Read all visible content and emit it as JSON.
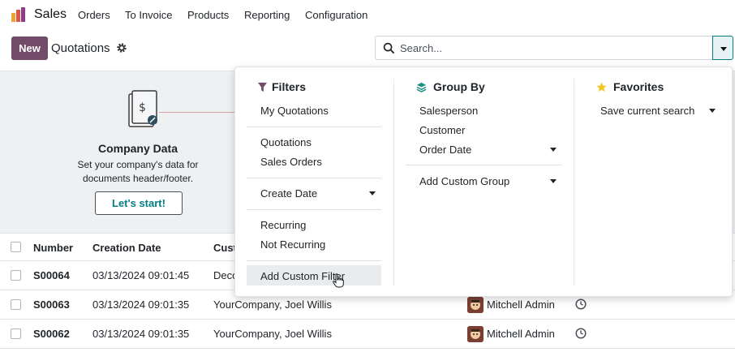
{
  "navbar": {
    "app_name": "Sales",
    "menu": [
      "Orders",
      "To Invoice",
      "Products",
      "Reporting",
      "Configuration"
    ]
  },
  "control": {
    "new_label": "New",
    "breadcrumb": "Quotations",
    "search_placeholder": "Search..."
  },
  "onboarding": {
    "title": "Company Data",
    "description": "Set your company's data for documents header/footer.",
    "button": "Let's start!"
  },
  "list": {
    "columns": [
      "Number",
      "Creation Date",
      "Cust"
    ],
    "rows": [
      {
        "number": "S00064",
        "date": "03/13/2024 09:01:45",
        "customer": "Deco",
        "salesperson": ""
      },
      {
        "number": "S00063",
        "date": "03/13/2024 09:01:35",
        "customer": "YourCompany, Joel Willis",
        "salesperson": "Mitchell Admin"
      },
      {
        "number": "S00062",
        "date": "03/13/2024 09:01:35",
        "customer": "YourCompany, Joel Willis",
        "salesperson": "Mitchell Admin"
      }
    ]
  },
  "filters": {
    "title": "Filters",
    "my_quotations": "My Quotations",
    "quotations": "Quotations",
    "sales_orders": "Sales Orders",
    "create_date": "Create Date",
    "recurring": "Recurring",
    "not_recurring": "Not Recurring",
    "add_custom": "Add Custom Filter"
  },
  "groupby": {
    "title": "Group By",
    "salesperson": "Salesperson",
    "customer": "Customer",
    "order_date": "Order Date",
    "add_custom": "Add Custom Group"
  },
  "favorites": {
    "title": "Favorites",
    "save_search": "Save current search"
  },
  "colors": {
    "brand": "#714B67",
    "accent": "#017e84",
    "filter_icon": "#714B67",
    "groupby_icon": "#1f8f86",
    "star": "#f3c623"
  },
  "icons": [
    "app-logo-icon",
    "gear-icon",
    "search-icon",
    "caret-down-icon",
    "funnel-icon",
    "layers-icon",
    "star-icon",
    "clock-icon",
    "hand-cursor-icon"
  ]
}
